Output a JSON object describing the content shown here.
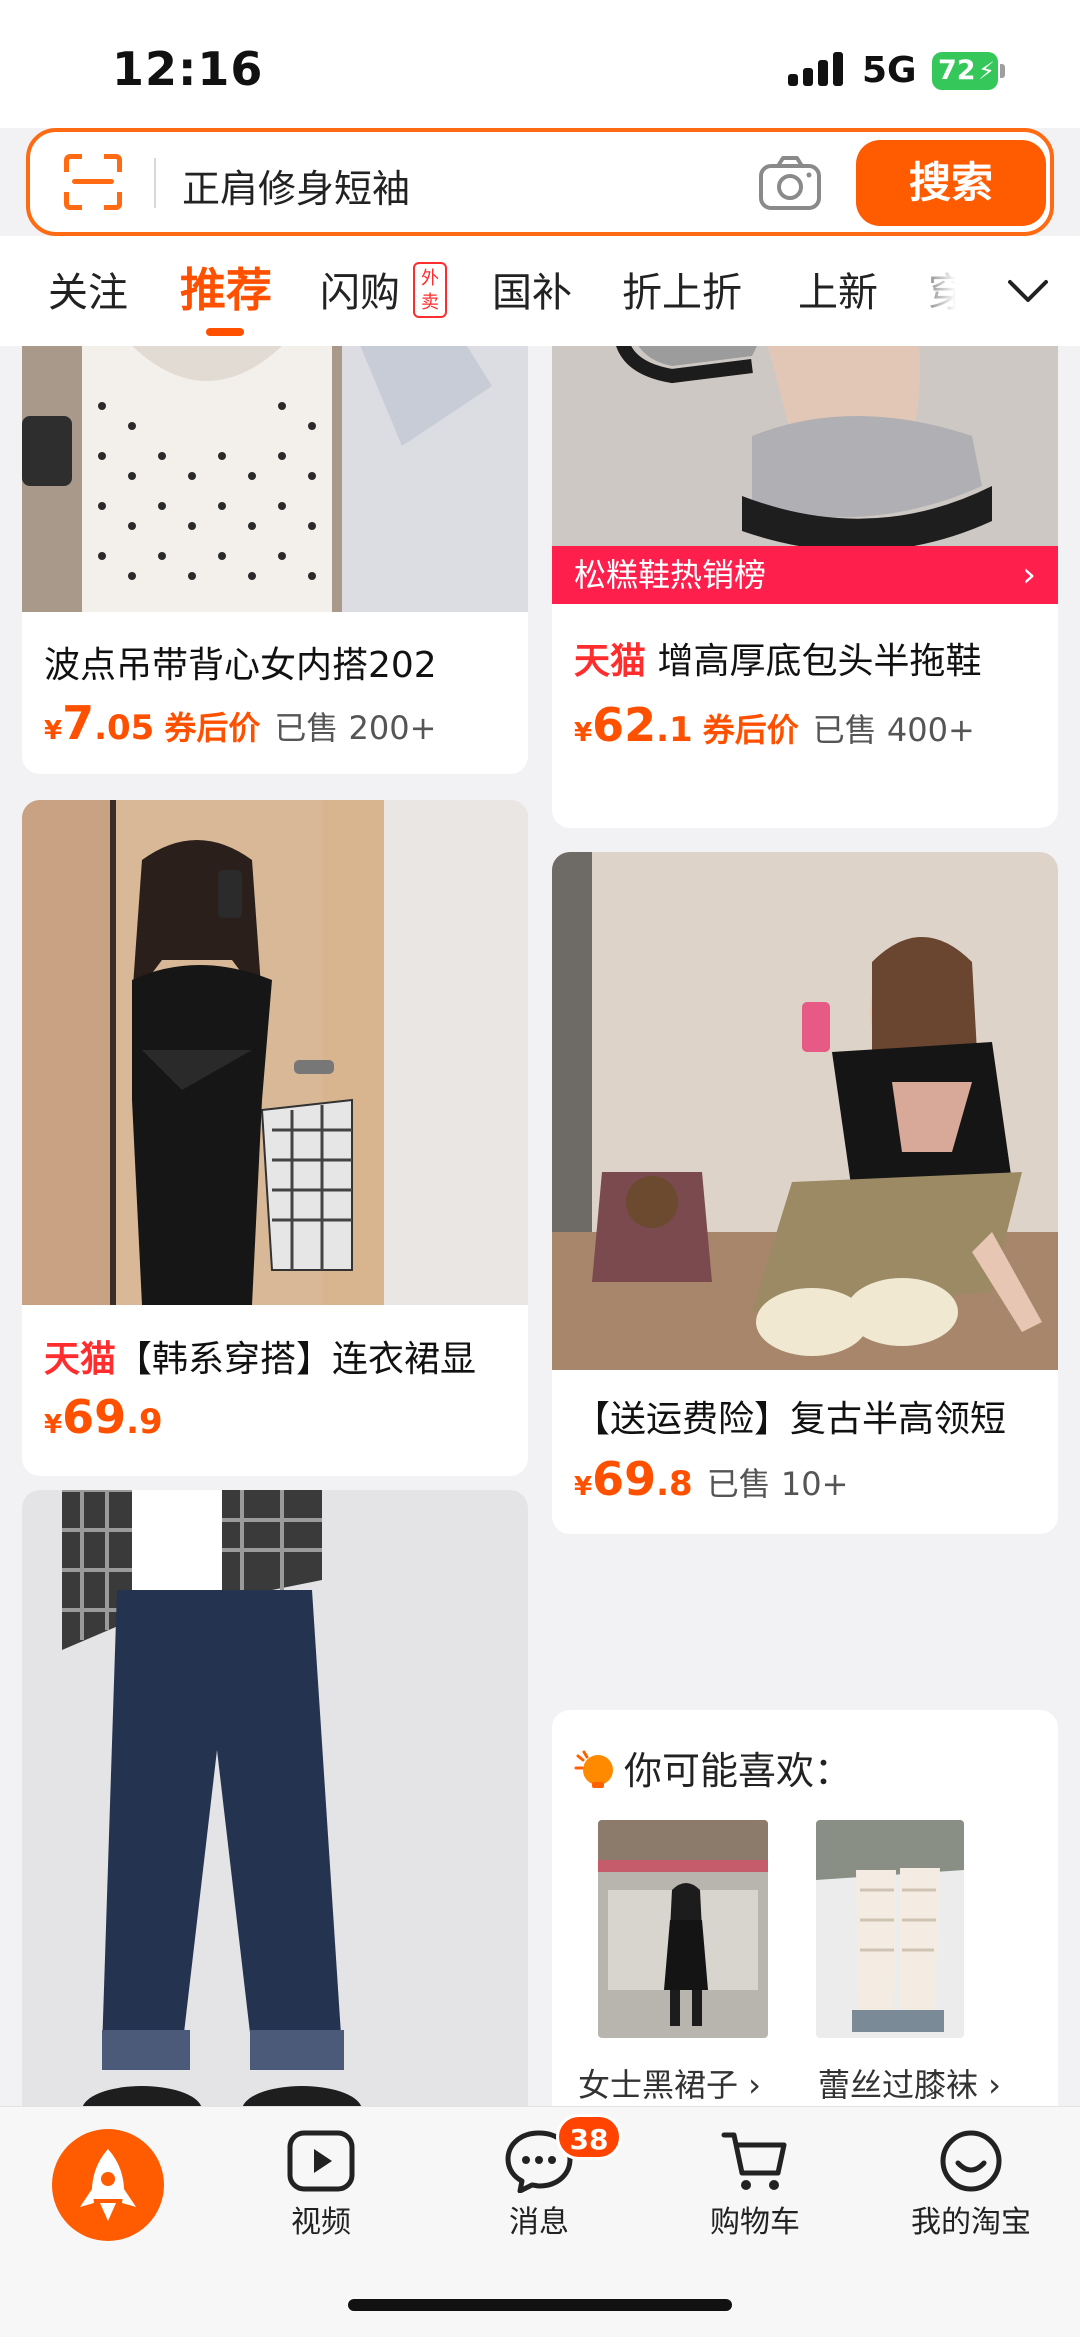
{
  "status_bar": {
    "time": "12:16",
    "network": "5G",
    "battery": "72"
  },
  "search": {
    "query": "正肩修身短袖",
    "button_label": "搜索"
  },
  "tabs": [
    {
      "label": "关注",
      "active": false
    },
    {
      "label": "推荐",
      "active": true
    },
    {
      "label": "闪购",
      "active": false,
      "badge": "外卖"
    },
    {
      "label": "国补",
      "active": false
    },
    {
      "label": "折上折",
      "active": false
    },
    {
      "label": "上新",
      "active": false
    },
    {
      "label": "穿",
      "active": false
    }
  ],
  "products": [
    {
      "title": "波点吊带背心女内搭202",
      "price_yen": "¥",
      "price_int": "7",
      "price_dec": ".05",
      "price_note": "券后价",
      "sold": "已售 200+"
    },
    {
      "banner": "松糕鞋热销榜",
      "brand": "天猫",
      "title": "增高厚底包头半拖鞋",
      "price_yen": "¥",
      "price_int": "62",
      "price_dec": ".1",
      "price_note": "券后价",
      "sold": "已售 400+"
    },
    {
      "brand": "天猫",
      "title": "【韩系穿搭】连衣裙显",
      "price_yen": "¥",
      "price_int": "69",
      "price_dec": ".9"
    },
    {
      "title": "【送运费险】复古半高领短",
      "price_yen": "¥",
      "price_int": "69",
      "price_dec": ".8",
      "sold": "已售 10+"
    }
  ],
  "recommend": {
    "header": "你可能喜欢：",
    "items": [
      {
        "label": "女士黑裙子 ›"
      },
      {
        "label": "蕾丝过膝袜 ›"
      }
    ]
  },
  "bottom_nav": {
    "items": [
      {
        "label": "视频",
        "icon": "video-icon"
      },
      {
        "label": "消息",
        "icon": "message-icon",
        "badge": "38"
      },
      {
        "label": "购物车",
        "icon": "cart-icon"
      },
      {
        "label": "我的淘宝",
        "icon": "profile-icon"
      }
    ]
  },
  "colors": {
    "accent": "#ff5000",
    "tmall": "#ff2d2d",
    "banner": "#ff1f4d",
    "battery": "#35c759"
  }
}
